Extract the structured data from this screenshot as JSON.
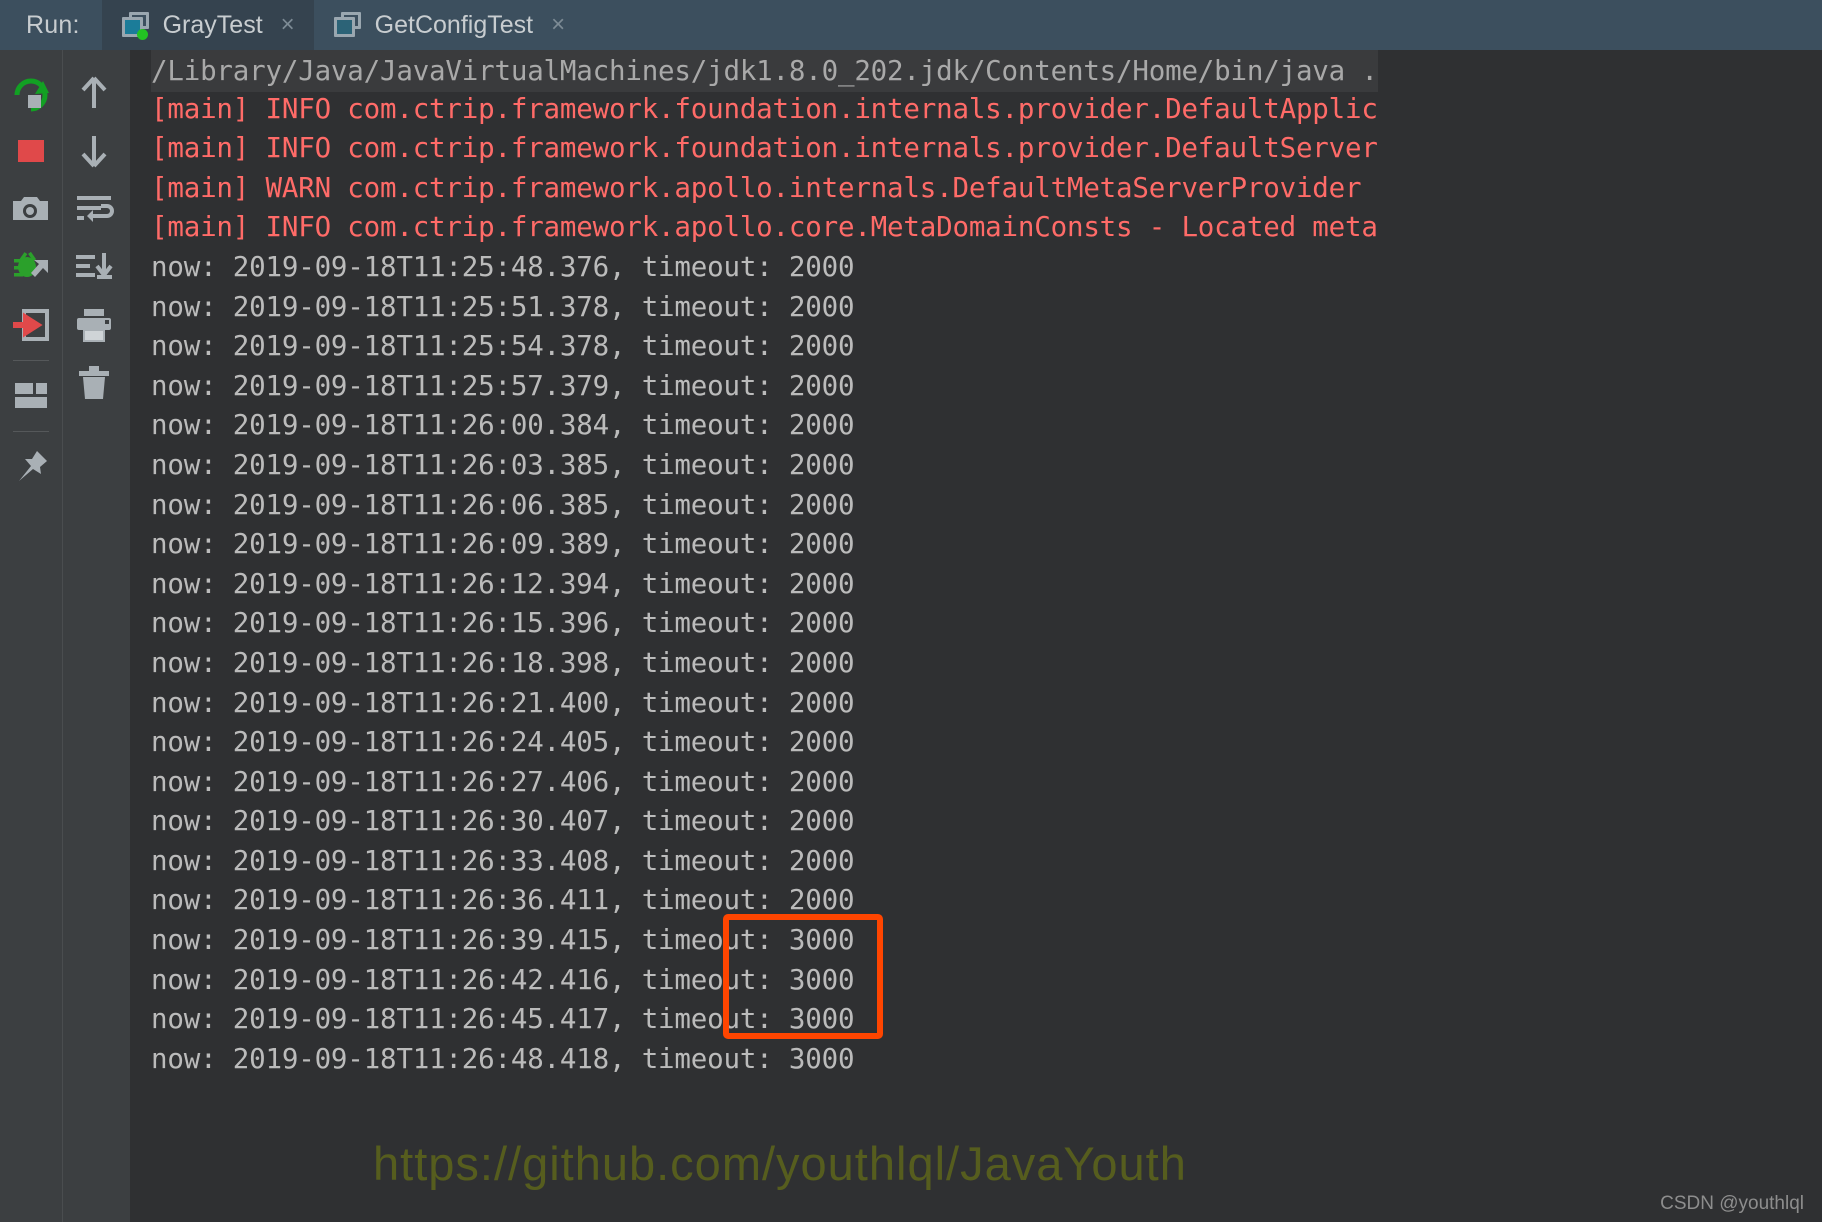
{
  "window": {
    "run_label": "Run:",
    "colors": {
      "tabbar_bg": "#3c4f5e",
      "console_bg": "#2f3032",
      "toolbar_bg": "#3c3f41",
      "error_text": "#ff6b68",
      "output_text": "#bbbbbb",
      "command_text": "#a9a9a9",
      "highlight_border": "#ff4500",
      "running_dot": "#23c223"
    }
  },
  "tabs": [
    {
      "label": "GrayTest",
      "close": "×",
      "active": true,
      "running": true
    },
    {
      "label": "GetConfigTest",
      "close": "×",
      "active": false,
      "running": false
    }
  ],
  "toolbar_left": [
    {
      "name": "rerun-icon",
      "title": "Rerun"
    },
    {
      "name": "stop-icon",
      "title": "Stop"
    },
    {
      "name": "camera-icon",
      "title": "Dump Threads"
    },
    {
      "name": "debug-attach-icon",
      "title": "Attach Debugger"
    },
    {
      "name": "import-icon",
      "title": "Import"
    },
    {
      "name": "layout-icon",
      "title": "Layout Settings"
    },
    {
      "name": "pin-icon",
      "title": "Pin Tab"
    }
  ],
  "toolbar_right": [
    {
      "name": "arrow-up-icon",
      "title": "Up the Stack Trace"
    },
    {
      "name": "arrow-down-icon",
      "title": "Down the Stack Trace"
    },
    {
      "name": "soft-wrap-icon",
      "title": "Use Soft Wraps"
    },
    {
      "name": "scroll-to-end-icon",
      "title": "Scroll to the End"
    },
    {
      "name": "print-icon",
      "title": "Print"
    },
    {
      "name": "trash-icon",
      "title": "Clear All"
    }
  ],
  "console": {
    "lines": [
      {
        "type": "command",
        "text": "/Library/Java/JavaVirtualMachines/jdk1.8.0_202.jdk/Contents/Home/bin/java ."
      },
      {
        "type": "error",
        "text": "[main] INFO com.ctrip.framework.foundation.internals.provider.DefaultApplic"
      },
      {
        "type": "error",
        "text": "[main] INFO com.ctrip.framework.foundation.internals.provider.DefaultServer"
      },
      {
        "type": "error",
        "text": "[main] WARN com.ctrip.framework.apollo.internals.DefaultMetaServerProvider"
      },
      {
        "type": "error",
        "text": "[main] INFO com.ctrip.framework.apollo.core.MetaDomainConsts - Located meta"
      },
      {
        "type": "output",
        "text": "now: 2019-09-18T11:25:48.376, timeout: 2000"
      },
      {
        "type": "output",
        "text": "now: 2019-09-18T11:25:51.378, timeout: 2000"
      },
      {
        "type": "output",
        "text": "now: 2019-09-18T11:25:54.378, timeout: 2000"
      },
      {
        "type": "output",
        "text": "now: 2019-09-18T11:25:57.379, timeout: 2000"
      },
      {
        "type": "output",
        "text": "now: 2019-09-18T11:26:00.384, timeout: 2000"
      },
      {
        "type": "output",
        "text": "now: 2019-09-18T11:26:03.385, timeout: 2000"
      },
      {
        "type": "output",
        "text": "now: 2019-09-18T11:26:06.385, timeout: 2000"
      },
      {
        "type": "output",
        "text": "now: 2019-09-18T11:26:09.389, timeout: 2000"
      },
      {
        "type": "output",
        "text": "now: 2019-09-18T11:26:12.394, timeout: 2000"
      },
      {
        "type": "output",
        "text": "now: 2019-09-18T11:26:15.396, timeout: 2000"
      },
      {
        "type": "output",
        "text": "now: 2019-09-18T11:26:18.398, timeout: 2000"
      },
      {
        "type": "output",
        "text": "now: 2019-09-18T11:26:21.400, timeout: 2000"
      },
      {
        "type": "output",
        "text": "now: 2019-09-18T11:26:24.405, timeout: 2000"
      },
      {
        "type": "output",
        "text": "now: 2019-09-18T11:26:27.406, timeout: 2000"
      },
      {
        "type": "output",
        "text": "now: 2019-09-18T11:26:30.407, timeout: 2000"
      },
      {
        "type": "output",
        "text": "now: 2019-09-18T11:26:33.408, timeout: 2000"
      },
      {
        "type": "output",
        "text": "now: 2019-09-18T11:26:36.411, timeout: 2000"
      },
      {
        "type": "output",
        "text": "now: 2019-09-18T11:26:39.415, timeout: 3000"
      },
      {
        "type": "output",
        "text": "now: 2019-09-18T11:26:42.416, timeout: 3000"
      },
      {
        "type": "output",
        "text": "now: 2019-09-18T11:26:45.417, timeout: 3000"
      },
      {
        "type": "output",
        "text": "now: 2019-09-18T11:26:48.418, timeout: 3000"
      }
    ]
  },
  "annotation": {
    "highlight_label": "timeout-3000-highlight"
  },
  "watermarks": {
    "github": "https://github.com/youthlql/JavaYouth",
    "csdn": "CSDN @youthlql"
  }
}
